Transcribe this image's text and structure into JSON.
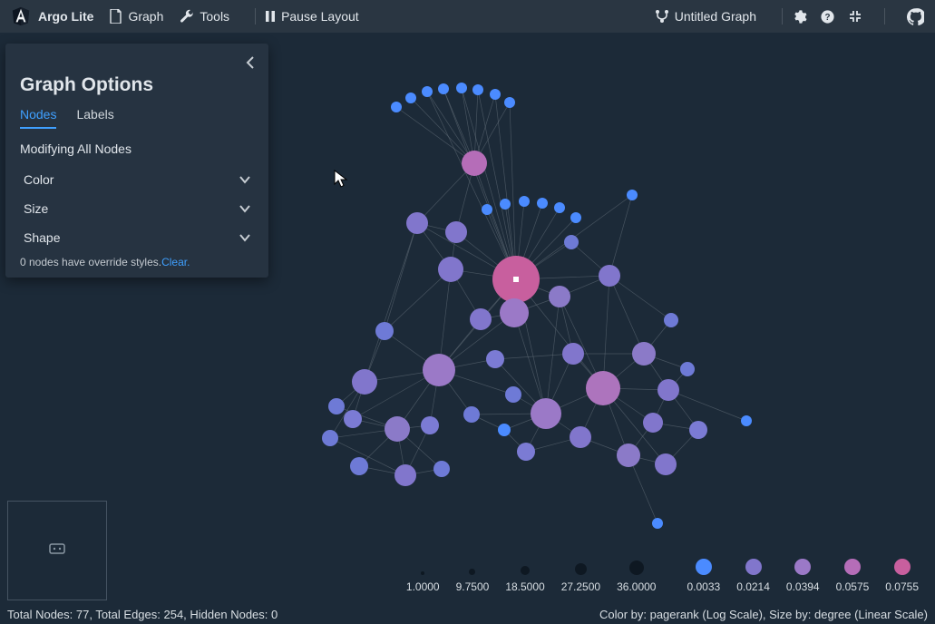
{
  "brand": "Argo Lite",
  "menu": {
    "graph": "Graph",
    "tools": "Tools",
    "pause": "Pause Layout"
  },
  "title": "Untitled Graph",
  "panel": {
    "heading": "Graph Options",
    "tabs": {
      "nodes": "Nodes",
      "labels": "Labels"
    },
    "modify_label": "Modifying All Nodes",
    "sections": {
      "color": "Color",
      "size": "Size",
      "shape": "Shape"
    },
    "override_text": "0 nodes have override styles.",
    "clear": "Clear."
  },
  "legend": {
    "sizes": [
      "1.0000",
      "9.7500",
      "18.5000",
      "27.2500",
      "36.0000"
    ],
    "colors": [
      "0.0033",
      "0.0214",
      "0.0394",
      "0.0575",
      "0.0755"
    ]
  },
  "status": {
    "left": "Total Nodes: 77, Total Edges: 254, Hidden Nodes: 0",
    "right": "Color by: pagerank (Log Scale), Size by: degree (Linear Scale)"
  }
}
